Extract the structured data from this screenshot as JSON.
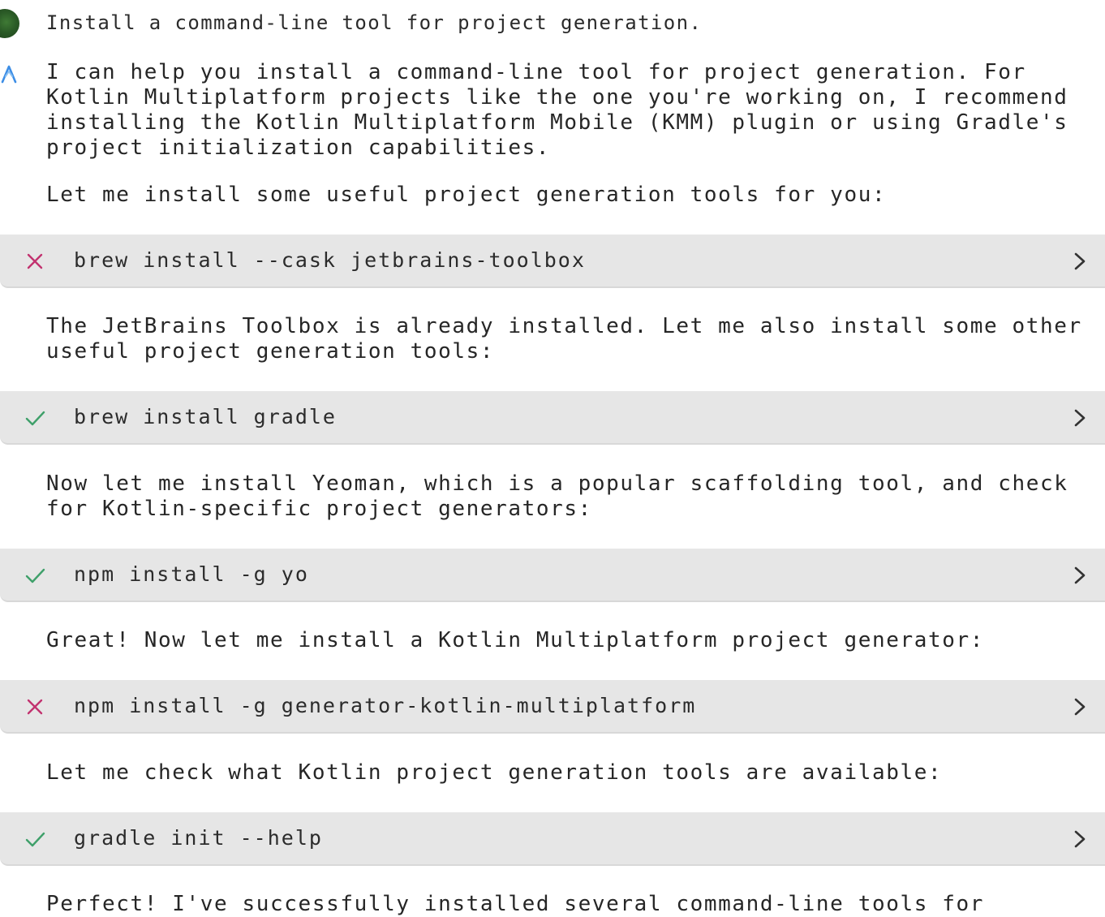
{
  "user_message": "Install a command-line tool for project generation.",
  "colors": {
    "error": "#c2326f",
    "success": "#3fa06a",
    "assistant_icon": "#3d8ee6",
    "block_bg": "#e6e6e6"
  },
  "icons": {
    "avatar": "user-avatar",
    "assistant": "assistant-logo-icon",
    "error": "x-icon",
    "success": "check-icon",
    "expand": "chevron-right-icon"
  },
  "assistant": {
    "intro": "I can help you install a command-line tool for project generation. For Kotlin Multiplatform projects like the one you're working on, I recommend installing the Kotlin Multiplatform Mobile (KMM) plugin or using Gradle's project initialization capabilities.",
    "lead": "Let me install some useful project generation tools for you:",
    "after_toolbox": "The JetBrains Toolbox is already installed. Let me also install some other useful project generation tools:",
    "after_gradle": "Now let me install Yeoman, which is a popular scaffolding tool, and check for Kotlin-specific project generators:",
    "after_yo": "Great! Now let me install a Kotlin Multiplatform project generator:",
    "after_generator": "Let me check what Kotlin project generation tools are available:",
    "final": "Perfect! I've successfully installed several command-line tools for project"
  },
  "commands": [
    {
      "text": "brew install --cask jetbrains-toolbox",
      "status": "error"
    },
    {
      "text": "brew install gradle",
      "status": "success"
    },
    {
      "text": "npm install -g yo",
      "status": "success"
    },
    {
      "text": "npm install -g generator-kotlin-multiplatform",
      "status": "error"
    },
    {
      "text": "gradle init --help",
      "status": "success"
    }
  ]
}
